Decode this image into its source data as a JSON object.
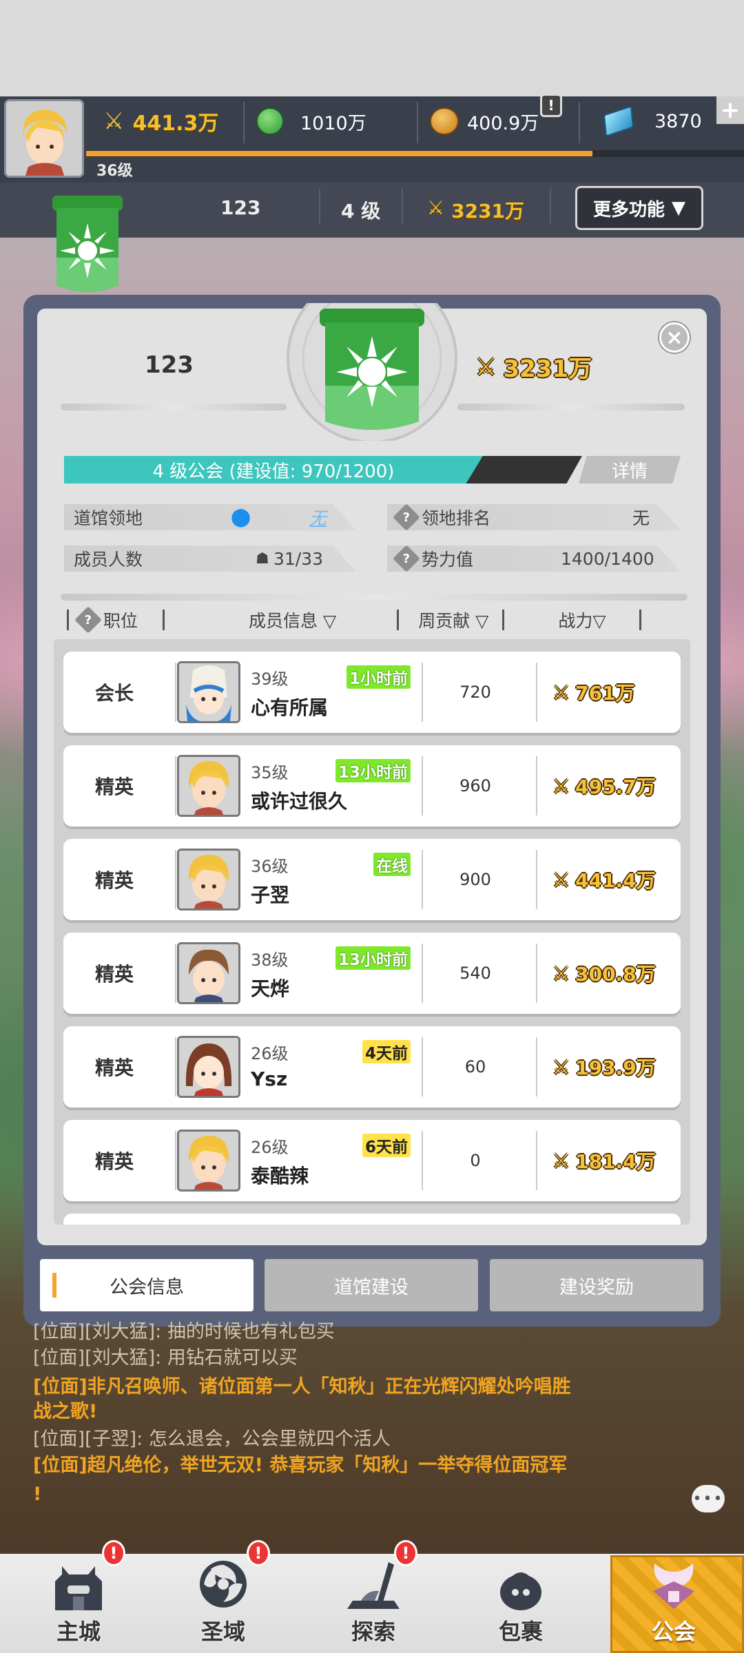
{
  "top_bar": {
    "player_level": "36级",
    "power": "441.3万",
    "green_currency": "1010万",
    "gold_currency": "400.9万",
    "gems": "3870",
    "notice_badge": "!",
    "add_symbol": "+",
    "xp_fraction": 0.77
  },
  "guild_row": {
    "guild_name": "123",
    "guild_level": "4 级",
    "guild_power": "3231万",
    "more_button": "更多功能",
    "more_arrow": "▼"
  },
  "panel": {
    "guild_name": "123",
    "guild_power": "3231万",
    "close_symbol": "×",
    "progress_text": "4 级公会 (建设值:  970/1200)",
    "progress_value": 970,
    "progress_max": 1200,
    "detail_button": "详情",
    "territory_label": "道馆领地",
    "territory_value": "无",
    "rank_label": "领地排名",
    "rank_value": "无",
    "members_label": "成员人数",
    "members_value": "31/33",
    "influence_label": "势力值",
    "influence_value": "1400/1400",
    "question_symbol": "?"
  },
  "table": {
    "headers": {
      "position": "职位",
      "member_info": "成员信息 ▽",
      "weekly_contribution": "周贡献 ▽",
      "power": "战力▽"
    },
    "rows": [
      {
        "position": "会长",
        "level": "39级",
        "name": "心有所属",
        "last_online": "1小时前",
        "contribution": "720",
        "power": "761万"
      },
      {
        "position": "精英",
        "level": "35级",
        "name": "或许过很久",
        "last_online": "13小时前",
        "contribution": "960",
        "power": "495.7万"
      },
      {
        "position": "精英",
        "level": "36级",
        "name": "子翌",
        "last_online": "在线",
        "contribution": "900",
        "power": "441.4万"
      },
      {
        "position": "精英",
        "level": "38级",
        "name": "天烨",
        "last_online": "13小时前",
        "contribution": "540",
        "power": "300.8万"
      },
      {
        "position": "精英",
        "level": "26级",
        "name": "Ysz",
        "last_online": "4天前",
        "contribution": "60",
        "power": "193.9万"
      },
      {
        "position": "精英",
        "level": "26级",
        "name": "泰酷辣",
        "last_online": "6天前",
        "contribution": "0",
        "power": "181.4万"
      }
    ]
  },
  "tabs": {
    "guild_info": "公会信息",
    "dojo_build": "道馆建设",
    "build_reward": "建设奖励"
  },
  "chat": {
    "line1": "[位面][刘大猛]:  抽的时候也有礼包买",
    "line2": "[位面][刘大猛]:  用钻石就可以买",
    "line3a": "[位面]非凡召唤师、诸位面第一人「知秋」正在光辉闪耀处吟唱胜",
    "line3b": "战之歌!",
    "line4": "[位面][子翌]:  怎么退会，公会里就四个活人",
    "line5a": "[位面]超凡绝伦，举世无双! 恭喜玩家「知秋」一举夺得位面冠军",
    "line5b": "!"
  },
  "bottom_nav": {
    "main_city": "主城",
    "holy_domain": "圣域",
    "explore": "探索",
    "bag": "包裹",
    "guild": "公会",
    "badge": "!"
  },
  "colors": {
    "accent_teal": "#3cc6bd",
    "accent_orange": "#f3a42c",
    "gold": "#f3c02e",
    "online_green": "#7fe82a",
    "offline_yellow": "#ffe14a"
  }
}
